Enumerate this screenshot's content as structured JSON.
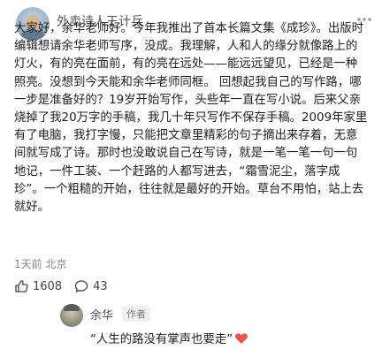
{
  "post": {
    "author": "外卖诗人王计兵",
    "body": "大家好，余华老师好。今年我推出了首本长篇文集《成珍》。出版时编辑想请余华老师写序，没成。我理解，人和人的缘分就像路上的灯火，有的亮在面前，有的亮在远处——能远远望见，已经是一种照亮。没想到今天能和余华老师同框。 回想起我自己的写作路，哪一步是准备好的？19岁开始写作，头些年一直在写小说。后来父亲烧掉了我20万字的手稿，我几十年只写作不保存手稿。2009年家里有了电脑，我打字慢，只能把文章里精彩的句子摘出来存着，无意间就写成了诗。那时也没敢说自己在写诗，就是一笔一笔一句一句地记，一件工装、一个赶路的人都写进去，“霜雪泥尘，落字成珍”。一个粗糙的开始，往往就是最好的开始。草台不用怕，站上去就好。",
    "time": "1天前",
    "location": "北京",
    "likes": "1608",
    "comments": "43"
  },
  "comment": {
    "name": "余华",
    "tag": "作者",
    "text": "“人生的路没有掌声也要走”"
  },
  "icons": {
    "more": "more-icon",
    "like": "thumb-up-icon",
    "comment": "comment-icon",
    "emoji": "heart-emoji-icon"
  },
  "colors": {
    "text": "#1e1e1e",
    "muted": "#888888",
    "emoji": "#e8564a"
  }
}
